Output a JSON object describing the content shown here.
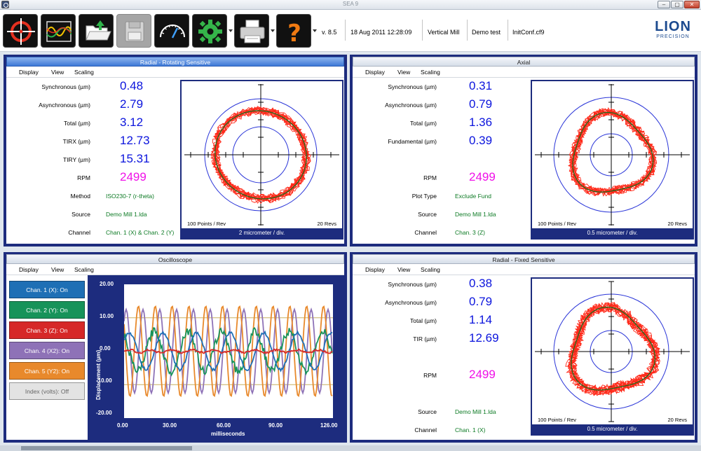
{
  "window": {
    "title": "SEA 9"
  },
  "toolbar": {
    "buttons": [
      {
        "name": "target-crosshair",
        "icon": "crosshair-icon"
      },
      {
        "name": "waveform",
        "icon": "waveform-icon"
      },
      {
        "name": "open-folder",
        "icon": "folder-open-icon"
      },
      {
        "name": "save-disk",
        "icon": "floppy-disk-icon"
      },
      {
        "name": "gauge",
        "icon": "gauge-icon"
      },
      {
        "name": "settings",
        "icon": "gear-icon"
      },
      {
        "name": "print",
        "icon": "printer-icon"
      },
      {
        "name": "help",
        "icon": "question-icon"
      }
    ],
    "version": "v. 8.5",
    "datetime": "18 Aug 2011 12:28:09",
    "machine": "Vertical Mill",
    "test": "Demo test",
    "config": "InitConf.cf9"
  },
  "logo": {
    "name": "LION",
    "tagline": "PRECISION",
    "color": "#1c4a8f"
  },
  "menu": {
    "display": "Display",
    "view": "View",
    "scaling": "Scaling"
  },
  "radial_rotating": {
    "title": "Radial - Rotating Sensitive",
    "rows": [
      {
        "label": "Synchronous (µm)",
        "value": "0.48"
      },
      {
        "label": "Asynchronous (µm)",
        "value": "2.79"
      },
      {
        "label": "Total (µm)",
        "value": "3.12"
      },
      {
        "label": "TIRX (µm)",
        "value": "12.73"
      },
      {
        "label": "TIRY (µm)",
        "value": "15.31"
      },
      {
        "label": "RPM",
        "value": "2499"
      },
      {
        "label": "Method",
        "value": "ISO230-7 (r-theta)"
      },
      {
        "label": "Source",
        "value": "Demo Mill 1.lda"
      },
      {
        "label": "Channel",
        "value": "Chan. 1 (X) & Chan. 2 (Y)"
      }
    ],
    "points": "100 Points / Rev",
    "revs": "20 Revs",
    "scale": "2 micrometer / div."
  },
  "axial": {
    "title": "Axial",
    "rows": [
      {
        "label": "Synchronous (µm)",
        "value": "0.31"
      },
      {
        "label": "Asynchronous (µm)",
        "value": "0.79"
      },
      {
        "label": "Total (µm)",
        "value": "1.36"
      },
      {
        "label": "Fundamental (µm)",
        "value": "0.39"
      },
      {
        "label": "RPM",
        "value": "2499"
      },
      {
        "label": "Plot Type",
        "value": "Exclude Fund"
      },
      {
        "label": "Source",
        "value": "Demo Mill 1.lda"
      },
      {
        "label": "Channel",
        "value": "Chan. 3 (Z)"
      }
    ],
    "points": "100 Points / Rev",
    "revs": "20 Revs",
    "scale": "0.5 micrometer / div."
  },
  "radial_fixed": {
    "title": "Radial - Fixed Sensitive",
    "rows": [
      {
        "label": "Synchronous (µm)",
        "value": "0.38"
      },
      {
        "label": "Asynchronous (µm)",
        "value": "0.79"
      },
      {
        "label": "Total (µm)",
        "value": "1.14"
      },
      {
        "label": "TIR (µm)",
        "value": "12.69"
      },
      {
        "label": "RPM",
        "value": "2499"
      },
      {
        "label": "Source",
        "value": "Demo Mill 1.lda"
      },
      {
        "label": "Channel",
        "value": "Chan. 1 (X)"
      }
    ],
    "points": "100 Points / Rev",
    "revs": "20 Revs",
    "scale": "0.5 micrometer / div."
  },
  "oscilloscope": {
    "title": "Oscilloscope",
    "channels": [
      {
        "label": "Chan. 1 (X): On",
        "color": "#1e6fb5"
      },
      {
        "label": "Chan. 2 (Y): On",
        "color": "#17935a"
      },
      {
        "label": "Chan. 3 (Z): On",
        "color": "#d62828"
      },
      {
        "label": "Chan. 4 (X2): On",
        "color": "#8e72b7"
      },
      {
        "label": "Chan. 5 (Y2): On",
        "color": "#e8892c"
      },
      {
        "label": "Index (volts): Off",
        "color": "#e3e3e3"
      }
    ],
    "ylabel": "Displacement (µm)",
    "xlabel": "milliseconds",
    "yticks": [
      "20.00",
      "10.00",
      "0.00",
      "-10.00",
      "-20.00"
    ],
    "xticks": [
      "0.00",
      "30.00",
      "60.00",
      "90.00",
      "126.00"
    ]
  },
  "colors": {
    "panel_frame": "#1d2c7e",
    "value_blue": "#0b14dd",
    "value_pink": "#f010e8",
    "text_green": "#0c7a24",
    "trace_red": "#ff2a1a",
    "trace_green": "#1d6b1d"
  }
}
